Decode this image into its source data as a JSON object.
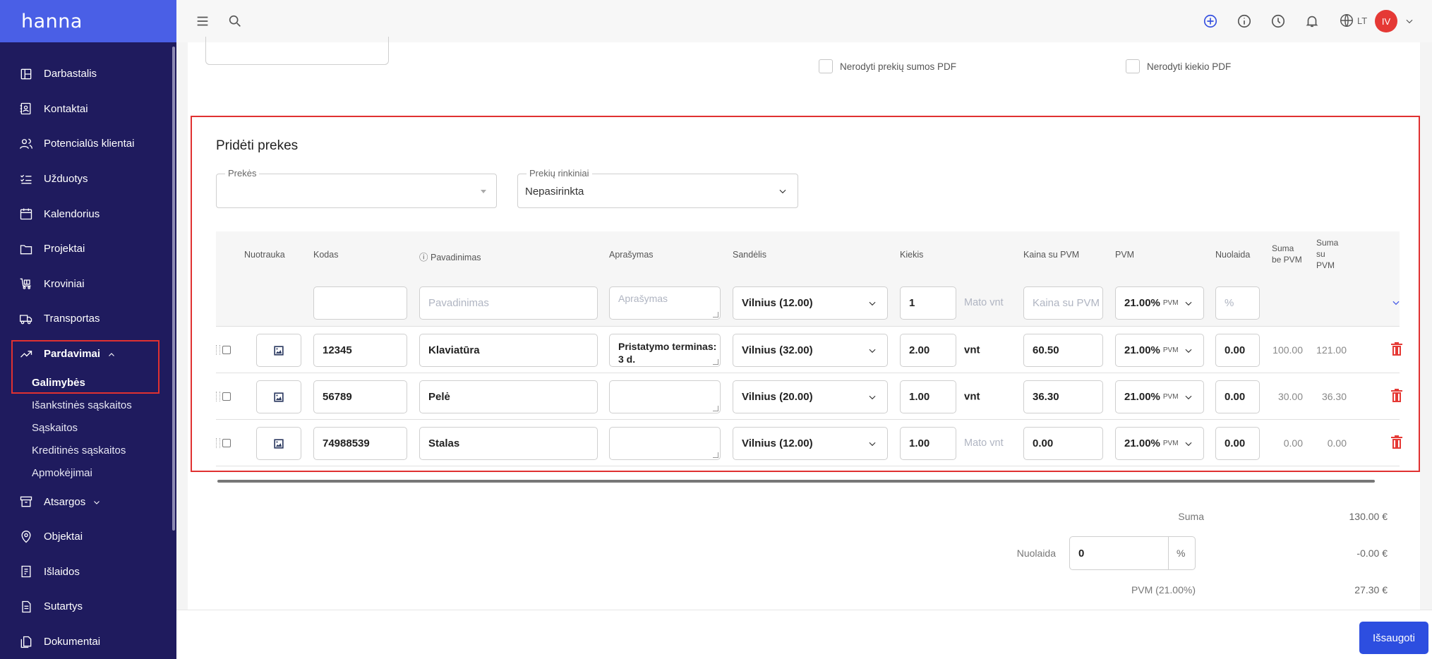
{
  "app": {
    "logo": "hanna"
  },
  "sidebar": {
    "items": [
      {
        "label": "Darbastalis",
        "icon": "dashboard-icon"
      },
      {
        "label": "Kontaktai",
        "icon": "contacts-icon"
      },
      {
        "label": "Potencialūs klientai",
        "icon": "leads-icon"
      },
      {
        "label": "Užduotys",
        "icon": "tasks-icon"
      },
      {
        "label": "Kalendorius",
        "icon": "calendar-icon"
      },
      {
        "label": "Projektai",
        "icon": "folder-icon"
      },
      {
        "label": "Kroviniai",
        "icon": "cargo-icon"
      },
      {
        "label": "Transportas",
        "icon": "truck-icon"
      },
      {
        "label": "Pardavimai",
        "icon": "trend-icon"
      }
    ],
    "sub_items": [
      "Galimybės",
      "Išankstinės sąskaitos",
      "Sąskaitos",
      "Kreditinės sąskaitos",
      "Apmokėjimai"
    ],
    "items_after": [
      {
        "label": "Atsargos",
        "icon": "archive-icon"
      },
      {
        "label": "Objektai",
        "icon": "location-icon"
      },
      {
        "label": "Išlaidos",
        "icon": "expenses-icon"
      },
      {
        "label": "Sutartys",
        "icon": "contract-icon"
      },
      {
        "label": "Dokumentai",
        "icon": "documents-icon"
      }
    ]
  },
  "topbar": {
    "language": "LT",
    "avatar_initials": "IV"
  },
  "options": {
    "hide_sum_pdf": "Nerodyti prekių sumos PDF",
    "hide_qty_pdf": "Nerodyti kiekio PDF"
  },
  "add_products": {
    "title": "Pridėti prekes",
    "products_label": "Prekės",
    "products_value": "",
    "sets_label": "Prekių rinkiniai",
    "sets_value": "Nepasirinkta"
  },
  "table": {
    "headers": {
      "photo": "Nuotrauka",
      "code": "Kodas",
      "name": "Pavadinimas",
      "description": "Aprašymas",
      "warehouse": "Sandėlis",
      "quantity": "Kiekis",
      "price": "Kaina su PVM",
      "vat": "PVM",
      "discount": "Nuolaida",
      "sum_no_vat": "Suma be PVM",
      "sum_vat": "Suma su PVM"
    },
    "new_row": {
      "name_placeholder": "Pavadinimas",
      "desc_placeholder": "Aprašymas",
      "warehouse": "Vilnius (12.00)",
      "quantity": "1",
      "unit_placeholder": "Mato vnt",
      "price_placeholder": "Kaina su PVM",
      "vat": "21.00%",
      "vat_tag": "PVM",
      "discount_placeholder": "%"
    },
    "rows": [
      {
        "code": "12345",
        "name": "Klaviatūra",
        "description": "Pristatymo terminas: 3 d.",
        "warehouse": "Vilnius (32.00)",
        "quantity": "2.00",
        "unit": "vnt",
        "price": "60.50",
        "vat": "21.00%",
        "discount": "0.00",
        "sum_no_vat": "100.00",
        "sum_vat": "121.00"
      },
      {
        "code": "56789",
        "name": "Pelė",
        "description": "",
        "warehouse": "Vilnius (20.00)",
        "quantity": "1.00",
        "unit": "vnt",
        "price": "36.30",
        "vat": "21.00%",
        "discount": "0.00",
        "sum_no_vat": "30.00",
        "sum_vat": "36.30"
      },
      {
        "code": "74988539",
        "name": "Stalas",
        "description": "",
        "warehouse": "Vilnius (12.00)",
        "quantity": "1.00",
        "unit": "Mato vnt",
        "price": "0.00",
        "vat": "21.00%",
        "discount": "0.00",
        "sum_no_vat": "0.00",
        "sum_vat": "0.00"
      }
    ]
  },
  "totals": {
    "sum_label": "Suma",
    "sum_value": "130.00 €",
    "discount_label": "Nuolaida",
    "discount_input": "0",
    "discount_unit": "%",
    "discount_value": "-0.00 €",
    "vat_label": "PVM (21.00%)",
    "vat_value": "27.30 €"
  },
  "footer": {
    "save_label": "Išsaugoti"
  }
}
